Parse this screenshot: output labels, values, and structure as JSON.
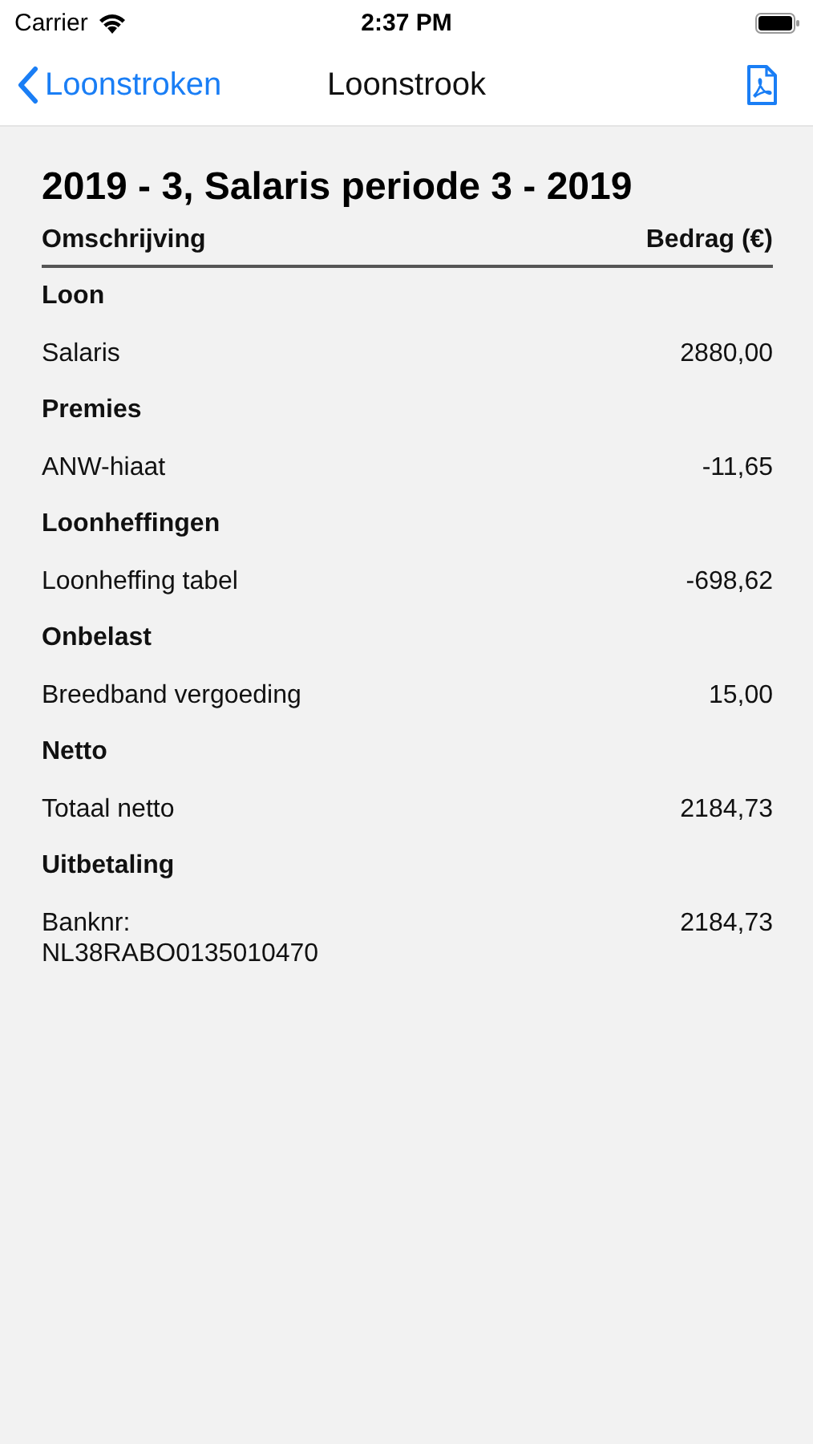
{
  "status_bar": {
    "carrier": "Carrier",
    "time": "2:37 PM"
  },
  "nav": {
    "back": "Loonstroken",
    "title": "Loonstrook"
  },
  "payslip": {
    "title": "2019 - 3, Salaris periode 3 - 2019",
    "columns": [
      "Omschrijving",
      "Bedrag (€)"
    ],
    "rows": [
      {
        "kind": "section",
        "label": "Loon"
      },
      {
        "kind": "line",
        "label": "Salaris",
        "amount": "2880,00"
      },
      {
        "kind": "section",
        "label": "Premies"
      },
      {
        "kind": "line",
        "label": "ANW-hiaat",
        "amount": "-11,65"
      },
      {
        "kind": "section",
        "label": "Loonheffingen"
      },
      {
        "kind": "line",
        "label": "Loonheffing tabel",
        "amount": "-698,62"
      },
      {
        "kind": "section",
        "label": "Onbelast"
      },
      {
        "kind": "line",
        "label": "Breedband vergoeding",
        "amount": "15,00"
      },
      {
        "kind": "section",
        "label": "Netto"
      },
      {
        "kind": "line",
        "label": "Totaal netto",
        "amount": "2184,73"
      },
      {
        "kind": "section",
        "label": "Uitbetaling"
      },
      {
        "kind": "line",
        "label": "Banknr: NL38RABO0135010470",
        "amount": "2184,73"
      }
    ]
  }
}
